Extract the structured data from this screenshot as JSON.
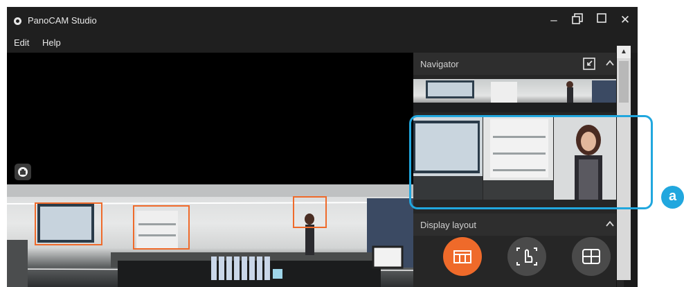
{
  "window": {
    "title": "PanoCAM Studio"
  },
  "menu": {
    "items": [
      "Edit",
      "Help"
    ]
  },
  "titlebar_icons": [
    "minimize-icon",
    "restore-window-icon",
    "maximize-icon",
    "close-icon"
  ],
  "navigator": {
    "title": "Navigator",
    "icons": [
      "collapse-view-icon",
      "chevron-up-icon"
    ]
  },
  "display_layout": {
    "title": "Display layout",
    "modes": [
      "grid-layout-icon",
      "hand-pan-icon",
      "quad-layout-icon"
    ],
    "selected": "grid-layout-icon"
  },
  "callout": {
    "label": "a"
  },
  "colors": {
    "accent_orange": "#ef6a2a",
    "highlight_blue": "#21a7de",
    "panel_bg": "#262626",
    "window_bg": "#1f1f1f"
  }
}
